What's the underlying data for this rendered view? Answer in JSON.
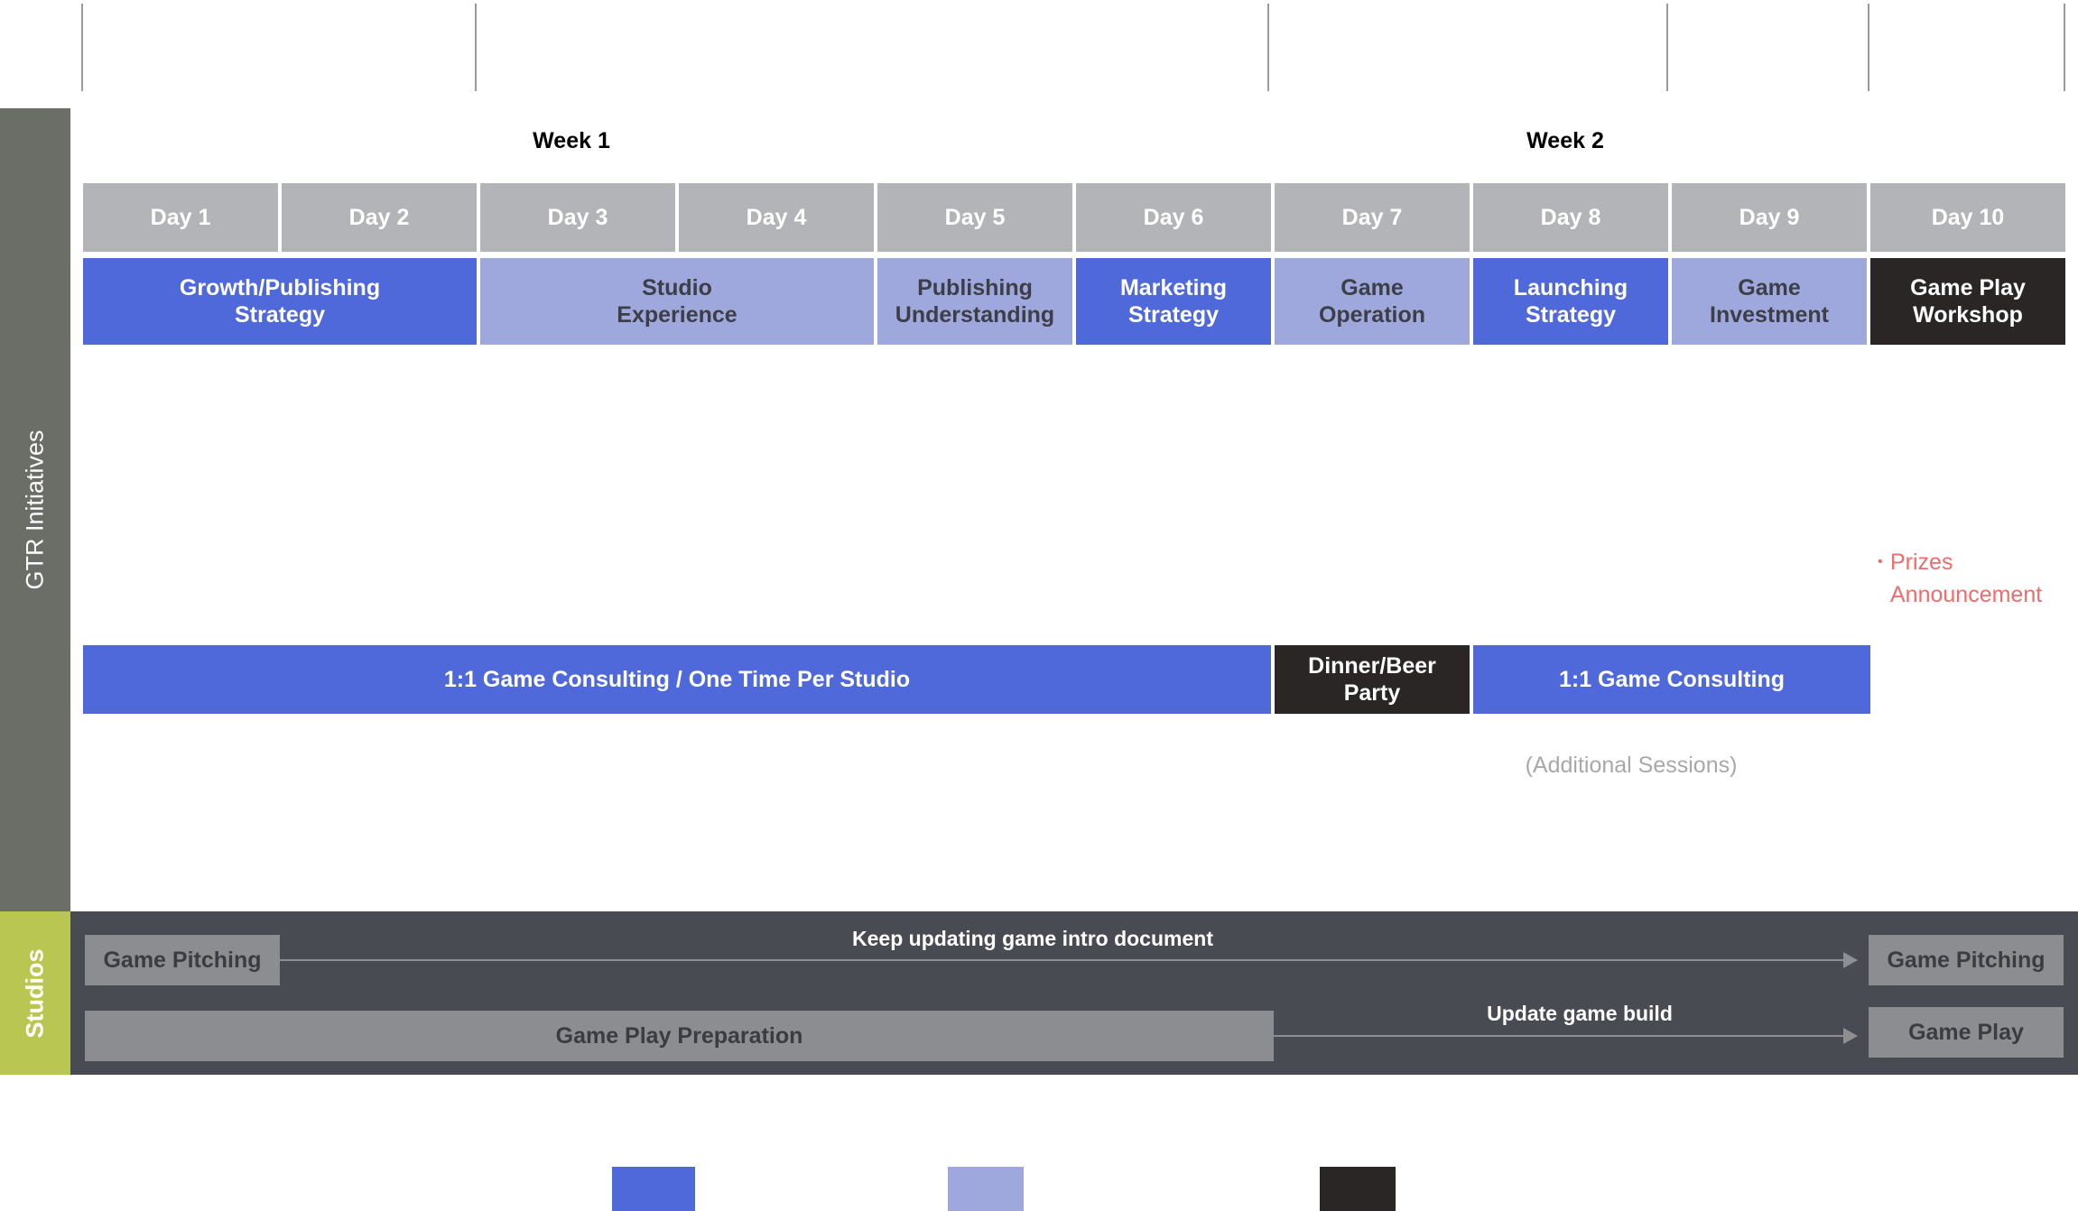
{
  "colors": {
    "core_session": "#5069da",
    "elective_session": "#9fa8dc",
    "event": "#2b2626",
    "day_header": "#b3b4b8",
    "gtr_sidebar": "#6b6e66",
    "studios_sidebar": "#b9c651",
    "studios_band": "#484b52",
    "studio_box": "#8c8d91",
    "prizes_text": "#f06b6b",
    "additional_text": "#a8a8a8"
  },
  "sidebar": {
    "gtr_label": "GTR Initiatives",
    "studios_label": "Studios"
  },
  "weeks": [
    {
      "label": "Week 1"
    },
    {
      "label": "Week 2"
    }
  ],
  "days": [
    {
      "label": "Day 1"
    },
    {
      "label": "Day 2"
    },
    {
      "label": "Day 3"
    },
    {
      "label": "Day 4"
    },
    {
      "label": "Day 5"
    },
    {
      "label": "Day 6"
    },
    {
      "label": "Day 7"
    },
    {
      "label": "Day 8"
    },
    {
      "label": "Day 9"
    },
    {
      "label": "Day 10"
    }
  ],
  "sessions": [
    {
      "label": "Growth/Publishing\nStrategy",
      "days": "1-2",
      "type": "core"
    },
    {
      "label": "Studio\nExperience",
      "days": "3-4",
      "type": "elective"
    },
    {
      "label": "Publishing\nUnderstanding",
      "days": "5",
      "type": "elective"
    },
    {
      "label": "Marketing\nStrategy",
      "days": "6",
      "type": "core"
    },
    {
      "label": "Game\nOperation",
      "days": "7",
      "type": "elective"
    },
    {
      "label": "Launching\nStrategy",
      "days": "8",
      "type": "core"
    },
    {
      "label": "Game\nInvestment",
      "days": "9",
      "type": "elective"
    },
    {
      "label": "Game Play\nWorkshop",
      "days": "10",
      "type": "event"
    }
  ],
  "prizes_note": "Prizes\nAnnouncement",
  "consulting": [
    {
      "label": "1:1 Game Consulting / One Time Per Studio",
      "days": "1-6",
      "type": "core"
    },
    {
      "label": "Dinner/Beer\nParty",
      "days": "7",
      "type": "event"
    },
    {
      "label": "1:1 Game Consulting",
      "days": "8-9",
      "type": "core"
    }
  ],
  "additional_sessions": "(Additional Sessions)",
  "studios": {
    "row1": {
      "start_label": "Game Pitching",
      "arrow_label": "Keep updating game intro document",
      "end_label": "Game Pitching"
    },
    "row2": {
      "start_label": "Game Play Preparation",
      "arrow_label": "Update game build",
      "end_label": "Game Play"
    }
  },
  "legend": [
    {
      "color": "#5069da"
    },
    {
      "color": "#9fa8dc"
    },
    {
      "color": "#2b2626"
    }
  ]
}
